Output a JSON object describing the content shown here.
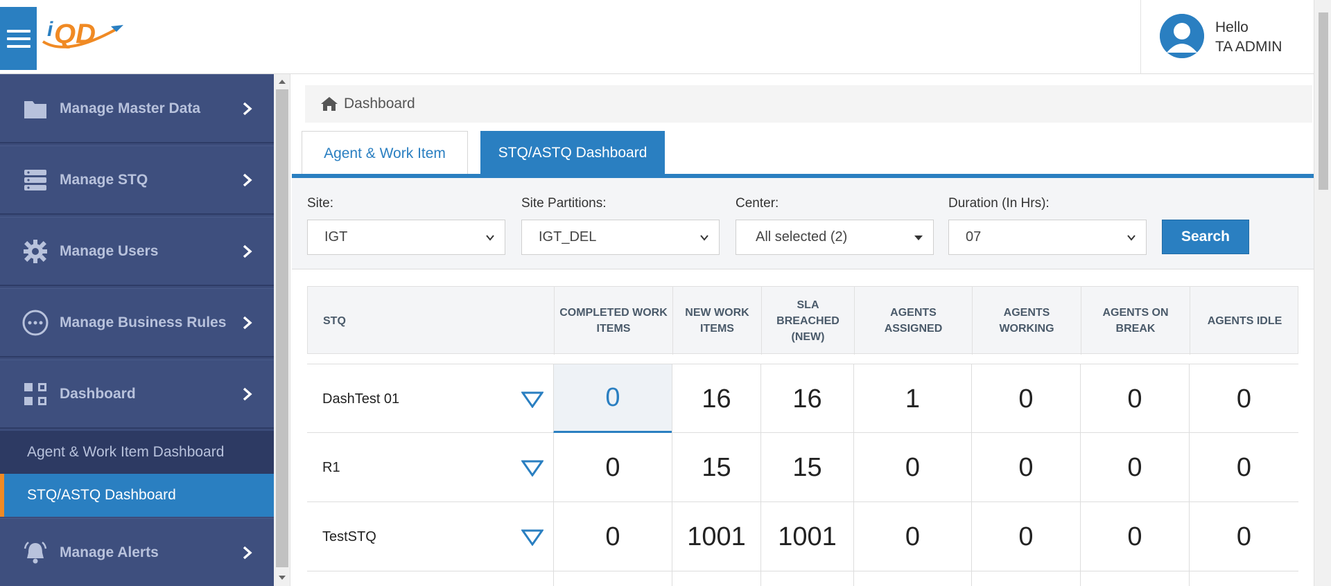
{
  "header": {
    "logo_text": "iQD",
    "greeting": "Hello",
    "user_name": "TA ADMIN"
  },
  "sidebar": {
    "items": [
      {
        "label": "Manage Master Data",
        "icon": "folder-icon"
      },
      {
        "label": "Manage STQ",
        "icon": "server-icon"
      },
      {
        "label": "Manage Users",
        "icon": "gear-icon"
      },
      {
        "label": "Manage Business Rules",
        "icon": "ellipsis-circle-icon"
      },
      {
        "label": "Dashboard",
        "icon": "dashboard-grid-icon"
      },
      {
        "label": "Manage Alerts",
        "icon": "bell-icon"
      }
    ],
    "sub_items": [
      {
        "label": "Agent & Work Item Dashboard",
        "active": false
      },
      {
        "label": "STQ/ASTQ Dashboard",
        "active": true
      }
    ]
  },
  "breadcrumb": {
    "label": "Dashboard"
  },
  "tabs": [
    {
      "label": "Agent & Work Item",
      "active": false
    },
    {
      "label": "STQ/ASTQ Dashboard",
      "active": true
    }
  ],
  "filters": {
    "site": {
      "label": "Site:",
      "value": "IGT"
    },
    "partitions": {
      "label": "Site Partitions:",
      "value": "IGT_DEL"
    },
    "center": {
      "label": "Center:",
      "value": "All selected (2)"
    },
    "duration": {
      "label": "Duration (In Hrs):",
      "value": "07"
    },
    "search_label": "Search"
  },
  "table": {
    "headers": [
      "STQ",
      "COMPLETED WORK ITEMS",
      "NEW WORK ITEMS",
      "SLA BREACHED (NEW)",
      "AGENTS ASSIGNED",
      "AGENTS WORKING",
      "AGENTS ON BREAK",
      "AGENTS IDLE"
    ],
    "rows": [
      {
        "name": "DashTest 01",
        "values": [
          "0",
          "16",
          "16",
          "1",
          "0",
          "0",
          "0"
        ]
      },
      {
        "name": "R1",
        "values": [
          "0",
          "15",
          "15",
          "0",
          "0",
          "0",
          "0"
        ]
      },
      {
        "name": "TestSTQ",
        "values": [
          "0",
          "1001",
          "1001",
          "0",
          "0",
          "0",
          "0"
        ]
      }
    ]
  },
  "colors": {
    "accent": "#2a7fc1",
    "sidebar": "#3e4f7e",
    "logo_orange": "#f08a24"
  }
}
